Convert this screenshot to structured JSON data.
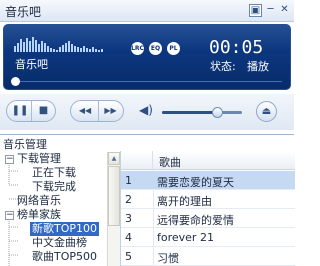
{
  "window": {
    "title": "音乐吧",
    "menu_icon": "▣",
    "minimize_icon": "─",
    "close_icon": "✕"
  },
  "display": {
    "track_name": "音乐吧",
    "time": "00:05",
    "status_label": "状态:",
    "status_value": "播放",
    "mode_icons": [
      "LRC",
      "EQ",
      "PL"
    ]
  },
  "controls": {
    "pause_icon": "❚❚",
    "stop_icon": "■",
    "prev_icon": "◀◀",
    "next_icon": "▶▶",
    "volume_icon": "◀)",
    "volume_level": 0.7,
    "eject_icon": "⏏"
  },
  "library": {
    "section_title": "音乐管理",
    "tree": [
      {
        "label": "下载管理",
        "level": 0,
        "expander": "−"
      },
      {
        "label": "正在下载",
        "level": 1
      },
      {
        "label": "下载完成",
        "level": 1
      },
      {
        "label": "网络音乐",
        "level": 0
      },
      {
        "label": "榜单家族",
        "level": 0,
        "expander": "−"
      },
      {
        "label": "新歌TOP100",
        "level": 1,
        "selected": true
      },
      {
        "label": "中文金曲榜",
        "level": 1
      },
      {
        "label": "歌曲TOP500",
        "level": 1
      }
    ],
    "column_header": "歌曲",
    "songs": [
      {
        "num": "1",
        "title": "需要恋爱的夏天",
        "selected": true
      },
      {
        "num": "2",
        "title": "离开的理由"
      },
      {
        "num": "3",
        "title": "远得要命的爱情"
      },
      {
        "num": "4",
        "title": "forever 21"
      },
      {
        "num": "5",
        "title": "习惯"
      }
    ]
  },
  "colors": {
    "display_bg": "#0b357c",
    "accent": "#316ac5",
    "row_selected": "#c5d9f3"
  }
}
